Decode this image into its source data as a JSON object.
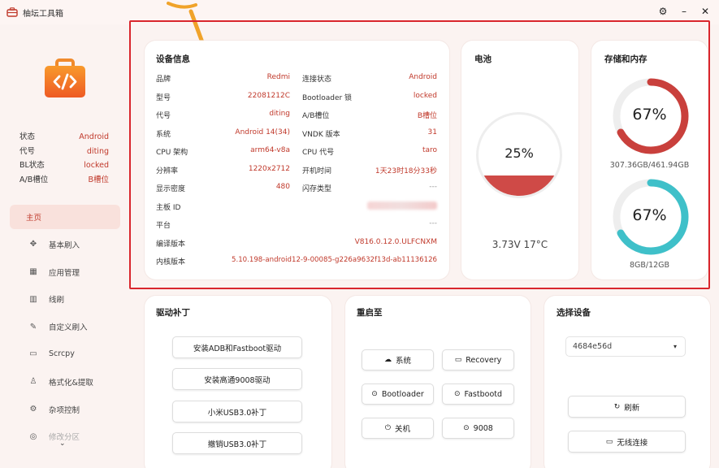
{
  "app": {
    "title": "柚坛工具箱"
  },
  "window_controls": {
    "settings": "⚙",
    "minimize": "–",
    "close": "✕"
  },
  "sidebar": {
    "status": [
      {
        "label": "状态",
        "value": "Android"
      },
      {
        "label": "代号",
        "value": "diting"
      },
      {
        "label": "BL状态",
        "value": "locked"
      },
      {
        "label": "A/B槽位",
        "value": "B槽位"
      }
    ],
    "nav": [
      {
        "label": "主页",
        "icon": "home-icon",
        "glyph": ""
      },
      {
        "label": "基本刷入",
        "icon": "flash-icon",
        "glyph": "✥"
      },
      {
        "label": "应用管理",
        "icon": "apps-icon",
        "glyph": "▦"
      },
      {
        "label": "线刷",
        "icon": "line-flash-icon",
        "glyph": "▥"
      },
      {
        "label": "自定义刷入",
        "icon": "custom-flash-icon",
        "glyph": "✎"
      },
      {
        "label": "Scrcpy",
        "icon": "screen-mirror-icon",
        "glyph": "▭"
      },
      {
        "label": "格式化&提取",
        "icon": "format-icon",
        "glyph": "♙"
      },
      {
        "label": "杂项控制",
        "icon": "misc-icon",
        "glyph": "⚙"
      },
      {
        "label": "修改分区",
        "icon": "partition-icon",
        "glyph": "◎"
      }
    ]
  },
  "device_info": {
    "title": "设备信息",
    "left": [
      {
        "label": "品牌",
        "value": "Redmi"
      },
      {
        "label": "型号",
        "value": "22081212C"
      },
      {
        "label": "代号",
        "value": "diting"
      },
      {
        "label": "系统",
        "value": "Android 14(34)"
      },
      {
        "label": "CPU 架构",
        "value": "arm64-v8a"
      },
      {
        "label": "分辨率",
        "value": "1220x2712"
      },
      {
        "label": "显示密度",
        "value": "480"
      },
      {
        "label": "主板 ID",
        "value": ""
      },
      {
        "label": "平台",
        "value": ""
      },
      {
        "label": "编译版本",
        "value": "V816.0.12.0.ULFCNXM"
      },
      {
        "label": "内核版本",
        "value": "5.10.198-android12-9-00085-g226a9632f13d-ab11136126"
      }
    ],
    "right": [
      {
        "label": "连接状态",
        "value": "Android"
      },
      {
        "label": "Bootloader 锁",
        "value": "locked"
      },
      {
        "label": "A/B槽位",
        "value": "B槽位"
      },
      {
        "label": "VNDK 版本",
        "value": "31"
      },
      {
        "label": "CPU 代号",
        "value": "taro"
      },
      {
        "label": "开机时间",
        "value": "1天23时18分33秒"
      },
      {
        "label": "闪存类型",
        "value": "---"
      }
    ],
    "platform_value": "---"
  },
  "battery": {
    "title": "电池",
    "percent": 25,
    "percent_label": "25%",
    "info": "3.73V 17°C",
    "color": "#cf4a47"
  },
  "storage": {
    "title": "存储和内存",
    "disk": {
      "percent": 67,
      "label": "67%",
      "detail": "307.36GB/461.94GB",
      "color": "#c9403c"
    },
    "memory": {
      "percent": 67,
      "label": "67%",
      "detail": "8GB/12GB",
      "color": "#3fc0c9"
    }
  },
  "driver": {
    "title": "驱动补丁",
    "buttons": [
      "安装ADB和Fastboot驱动",
      "安装高通9008驱动",
      "小米USB3.0补丁",
      "撤销USB3.0补丁"
    ]
  },
  "reboot": {
    "title": "重启至",
    "buttons": [
      {
        "label": "系统",
        "icon": "cloud-icon",
        "glyph": "☁"
      },
      {
        "label": "Recovery",
        "icon": "monitor-icon",
        "glyph": "▭"
      },
      {
        "label": "Bootloader",
        "icon": "bootloader-icon",
        "glyph": "⊙"
      },
      {
        "label": "Fastbootd",
        "icon": "fastbootd-icon",
        "glyph": "⊙"
      },
      {
        "label": "关机",
        "icon": "power-icon",
        "glyph": "⏻"
      },
      {
        "label": "9008",
        "icon": "edl-icon",
        "glyph": "⊙"
      }
    ]
  },
  "device_select": {
    "title": "选择设备",
    "selected": "4684e56d",
    "refresh_label": "刷新",
    "wireless_label": "无线连接"
  }
}
